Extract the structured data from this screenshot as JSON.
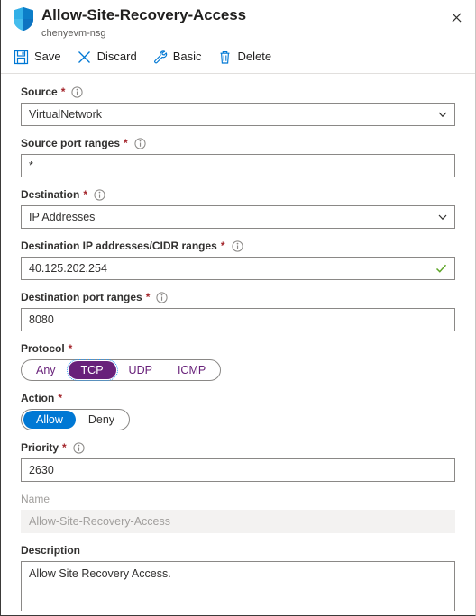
{
  "header": {
    "icon": "shield-icon",
    "title": "Allow-Site-Recovery-Access",
    "subtitle": "chenyevm-nsg",
    "close_icon": "close-icon"
  },
  "commandbar": {
    "items": [
      {
        "label": "Save",
        "icon": "save-icon"
      },
      {
        "label": "Discard",
        "icon": "discard-icon"
      },
      {
        "label": "Basic",
        "icon": "wrench-icon"
      },
      {
        "label": "Delete",
        "icon": "trash-icon"
      }
    ]
  },
  "form": {
    "source": {
      "label": "Source",
      "required": "*",
      "info_icon": "info-icon",
      "value": "VirtualNetwork",
      "chevron_icon": "chevron-down-icon"
    },
    "source_port_ranges": {
      "label": "Source port ranges",
      "required": "*",
      "info_icon": "info-icon",
      "value": "*"
    },
    "destination": {
      "label": "Destination",
      "required": "*",
      "info_icon": "info-icon",
      "value": "IP Addresses",
      "chevron_icon": "chevron-down-icon"
    },
    "destination_ip": {
      "label": "Destination IP addresses/CIDR ranges",
      "required": "*",
      "info_icon": "info-icon",
      "value": "40.125.202.254",
      "valid_icon": "checkmark-icon"
    },
    "destination_port_ranges": {
      "label": "Destination port ranges",
      "required": "*",
      "info_icon": "info-icon",
      "value": "8080"
    },
    "protocol": {
      "label": "Protocol",
      "required": "*",
      "options": [
        "Any",
        "TCP",
        "UDP",
        "ICMP"
      ],
      "selected": "TCP",
      "selected_color": "#68217a"
    },
    "action": {
      "label": "Action",
      "required": "*",
      "options": [
        "Allow",
        "Deny"
      ],
      "selected": "Allow",
      "selected_color": "#0078d4"
    },
    "priority": {
      "label": "Priority",
      "required": "*",
      "info_icon": "info-icon",
      "value": "2630"
    },
    "name": {
      "label": "Name",
      "value": "Allow-Site-Recovery-Access",
      "disabled": true
    },
    "description": {
      "label": "Description",
      "value": "Allow Site Recovery Access."
    }
  }
}
